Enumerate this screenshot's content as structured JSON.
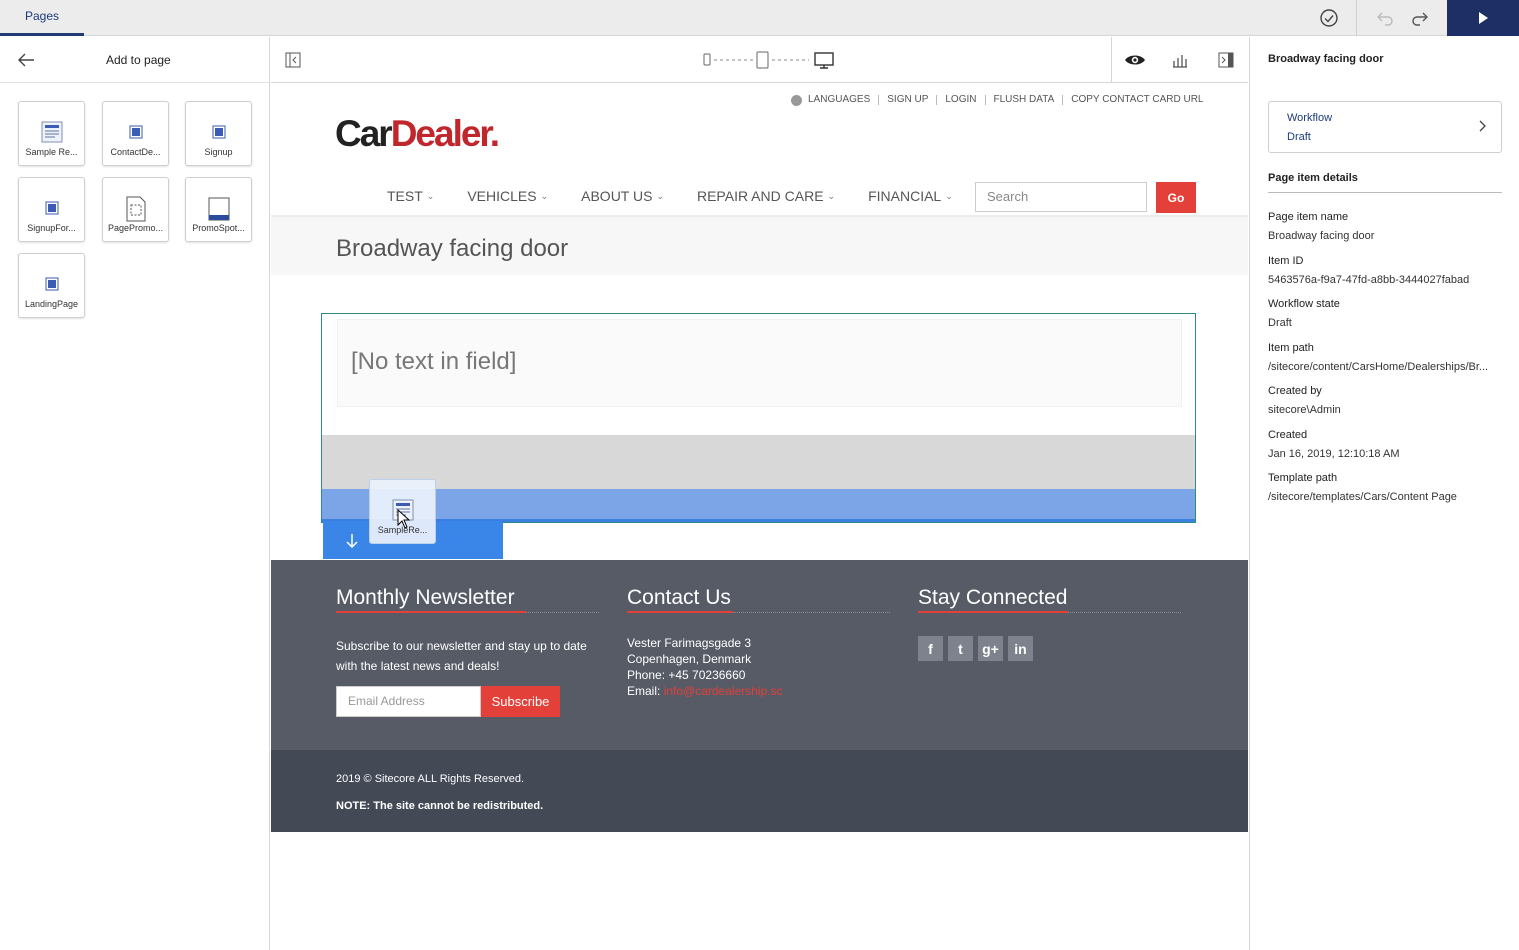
{
  "topbar": {
    "tab_label": "Pages"
  },
  "left_panel": {
    "title": "Add to page",
    "components": [
      {
        "label": "Sample Re...",
        "icon": "rendering-icon"
      },
      {
        "label": "ContactDe...",
        "icon": "component-icon"
      },
      {
        "label": "Signup",
        "icon": "component-icon"
      },
      {
        "label": "SignupFor...",
        "icon": "component-icon"
      },
      {
        "label": "PagePromo...",
        "icon": "page-placeholder-icon"
      },
      {
        "label": "PromoSpot...",
        "icon": "promo-icon"
      },
      {
        "label": "LandingPage",
        "icon": "component-icon"
      }
    ]
  },
  "right_panel": {
    "title": "Broadway facing door",
    "workflow": {
      "label": "Workflow",
      "value": "Draft"
    },
    "section_title": "Page item details",
    "details": [
      {
        "key": "Page item name",
        "value": "Broadway facing door"
      },
      {
        "key": "Item ID",
        "value": "5463576a-f9a7-47fd-a8bb-3444027fabad"
      },
      {
        "key": "Workflow state",
        "value": "Draft"
      },
      {
        "key": "Item path",
        "value": "/sitecore/content/CarsHome/Dealerships/Br..."
      },
      {
        "key": "Created by",
        "value": "sitecore\\Admin"
      },
      {
        "key": "Created",
        "value": "Jan 16, 2019, 12:10:18 AM"
      },
      {
        "key": "Template path",
        "value": "/sitecore/templates/Cars/Content Page"
      }
    ]
  },
  "site": {
    "util_links": [
      "LANGUAGES",
      "SIGN UP",
      "LOGIN",
      "FLUSH DATA",
      "COPY CONTACT CARD URL"
    ],
    "logo": {
      "part1": "Car",
      "part2": "Dealer."
    },
    "nav": [
      "TEST",
      "VEHICLES",
      "ABOUT US",
      "REPAIR AND CARE",
      "FINANCIAL"
    ],
    "search_placeholder": "Search",
    "go_label": "Go",
    "page_title": "Broadway facing door",
    "empty_field_text": "[No text in field]",
    "drag_label": "SampleRe...",
    "footer": {
      "newsletter_title": "Monthly Newsletter",
      "newsletter_text": "Subscribe to our newsletter and stay up to date with the latest news and deals!",
      "email_placeholder": "Email Address",
      "subscribe_label": "Subscribe",
      "contact_title": "Contact Us",
      "address1": "Vester Farimagsgade 3",
      "address2": "Copenhagen, Denmark",
      "phone": "Phone: +45 70236660",
      "email_label": "Email:",
      "email_value": "info@cardealership.sc",
      "connected_title": "Stay Connected",
      "social": [
        "f",
        "t",
        "g+",
        "in"
      ]
    },
    "copyright": "2019 © Sitecore ALL Rights Reserved.",
    "note": "NOTE: The site cannot be redistributed."
  },
  "colors": {
    "publish": "#1e2f66",
    "accent_red": "#e3403a",
    "drop_blue": "#7ba5e6",
    "footer_bg": "#565b66"
  }
}
